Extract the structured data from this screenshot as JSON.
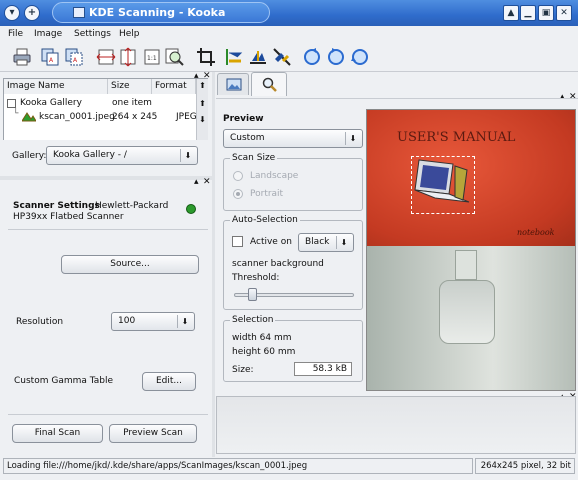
{
  "window": {
    "title": "KDE Scanning - Kooka"
  },
  "menu": [
    "File",
    "Image",
    "Settings",
    "Help"
  ],
  "image_list": {
    "headers": [
      "Image Name",
      "Size",
      "Format"
    ],
    "rows": [
      {
        "name": "Kooka Gallery",
        "size": "one item",
        "format": ""
      },
      {
        "name": "kscan_0001.jpeg",
        "size": "264 x 245",
        "format": "JPEG"
      }
    ]
  },
  "gallery": {
    "label": "Gallery:",
    "value": "Kooka Gallery - /"
  },
  "scanner": {
    "settings_label": "Scanner Settings",
    "vendor": "Hewlett-Packard",
    "model": "HP39xx Flatbed Scanner",
    "source_button": "Source...",
    "resolution_label": "Resolution",
    "resolution_value": "100",
    "gamma_label": "Custom Gamma Table",
    "gamma_button": "Edit...",
    "final_scan": "Final Scan",
    "preview_scan": "Preview Scan"
  },
  "preview": {
    "heading": "Preview",
    "size_combo": "Custom",
    "scan_size": {
      "title": "Scan Size",
      "landscape": "Landscape",
      "portrait": "Portrait"
    },
    "auto_selection": {
      "title": "Auto-Selection",
      "active_on": "Active on",
      "color": "Black",
      "bg_text": "scanner background",
      "threshold": "Threshold:",
      "threshold_level": 0.12
    },
    "selection": {
      "title": "Selection",
      "width": "width 64 mm",
      "height": "height 60 mm",
      "size_label": "Size:",
      "size_value": "58.3 kB"
    },
    "image_text": {
      "title": "USER'S MANUAL",
      "subtitle": "notebook"
    }
  },
  "status": {
    "left": "Loading file:///home/jkd/.kde/share/apps/ScanImages/kscan_0001.jpeg",
    "right": "264x245 pixel, 32 bit"
  },
  "colors": {
    "titlebar": "#3b78d6",
    "manual_red": "#d8452a",
    "panel": "#eef0f3"
  }
}
